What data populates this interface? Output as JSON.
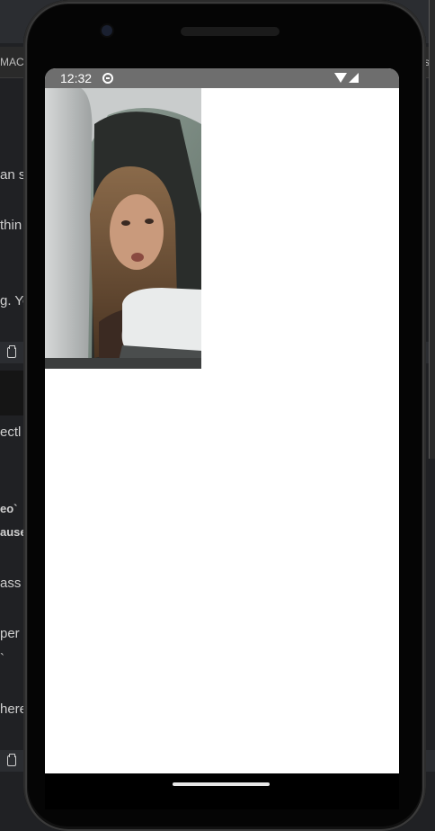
{
  "background_app": {
    "tab_left_fragment": "MACI",
    "tab_right_fragment": "s l",
    "text_fragments": [
      {
        "text": "an s",
        "bold": false
      },
      {
        "text": "thin",
        "bold": false
      },
      {
        "text": "g. Yo",
        "bold": false
      },
      {
        "text": "ectl",
        "bold": false
      },
      {
        "text": "eo`",
        "bold": true
      },
      {
        "text": "ause",
        "bold": true
      },
      {
        "text": "ass",
        "bold": false
      },
      {
        "text": "per",
        "bold": false
      },
      {
        "text": "`",
        "bold": false
      },
      {
        "text": "here",
        "bold": false
      }
    ]
  },
  "phone": {
    "status_bar": {
      "time": "12:32",
      "icons": [
        "dnd-icon",
        "wifi-icon",
        "signal-icon"
      ]
    },
    "video": {
      "description_icon": "video-frame"
    }
  },
  "colors": {
    "status_bar_bg": "#6e6e6e",
    "screen_bg": "#ffffff",
    "phone_body": "#050505"
  }
}
